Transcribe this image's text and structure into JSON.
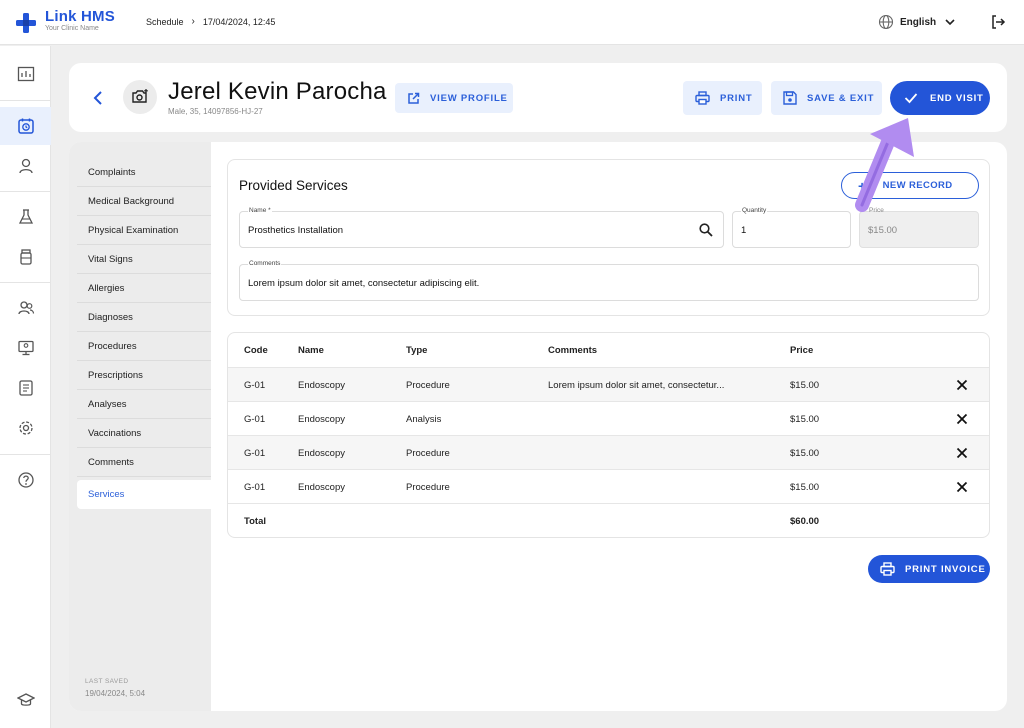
{
  "app": {
    "name": "Link HMS",
    "subtitle": "Your Clinic Name"
  },
  "breadcrumb": {
    "section": "Schedule",
    "item": "17/04/2024, 12:45"
  },
  "language": {
    "selected": "English"
  },
  "patient": {
    "name": "Jerel Kevin Parocha",
    "meta": "Male, 35, 14097856-HJ-27"
  },
  "actions": {
    "view_profile": "VIEW PROFILE",
    "print": "PRINT",
    "save_exit": "SAVE & EXIT",
    "end_visit": "END VISIT"
  },
  "nav": [
    "Complaints",
    "Medical Background",
    "Physical Examination",
    "Vital Signs",
    "Allergies",
    "Diagnoses",
    "Procedures",
    "Prescriptions",
    "Analyses",
    "Vaccinations",
    "Comments",
    "Services"
  ],
  "nav_active": "Services",
  "last_saved": {
    "label": "LAST SAVED",
    "value": "19/04/2024, 5:04"
  },
  "form": {
    "title": "Provided Services",
    "new_record": "NEW RECORD",
    "name": {
      "label": "Name *",
      "value": "Prosthetics Installation"
    },
    "quantity": {
      "label": "Quantity",
      "value": "1"
    },
    "price": {
      "label": "Price",
      "value": "$15.00"
    },
    "comments": {
      "label": "Comments",
      "value": "Lorem ipsum dolor sit amet, consectetur adipiscing elit."
    }
  },
  "table": {
    "headers": {
      "code": "Code",
      "name": "Name",
      "type": "Type",
      "comments": "Comments",
      "price": "Price"
    },
    "rows": [
      {
        "code": "G-01",
        "name": "Endoscopy",
        "type": "Procedure",
        "comments": "Lorem ipsum dolor sit amet, consectetur...",
        "price": "$15.00"
      },
      {
        "code": "G-01",
        "name": "Endoscopy",
        "type": "Analysis",
        "comments": "",
        "price": "$15.00"
      },
      {
        "code": "G-01",
        "name": "Endoscopy",
        "type": "Procedure",
        "comments": "",
        "price": "$15.00"
      },
      {
        "code": "G-01",
        "name": "Endoscopy",
        "type": "Procedure",
        "comments": "",
        "price": "$15.00"
      }
    ],
    "total": {
      "label": "Total",
      "value": "$60.00"
    }
  },
  "print_invoice": "PRINT INVOICE",
  "colors": {
    "primary": "#2355d8",
    "primary_light": "#e9f0fd",
    "annotation": "#b18cf0"
  }
}
